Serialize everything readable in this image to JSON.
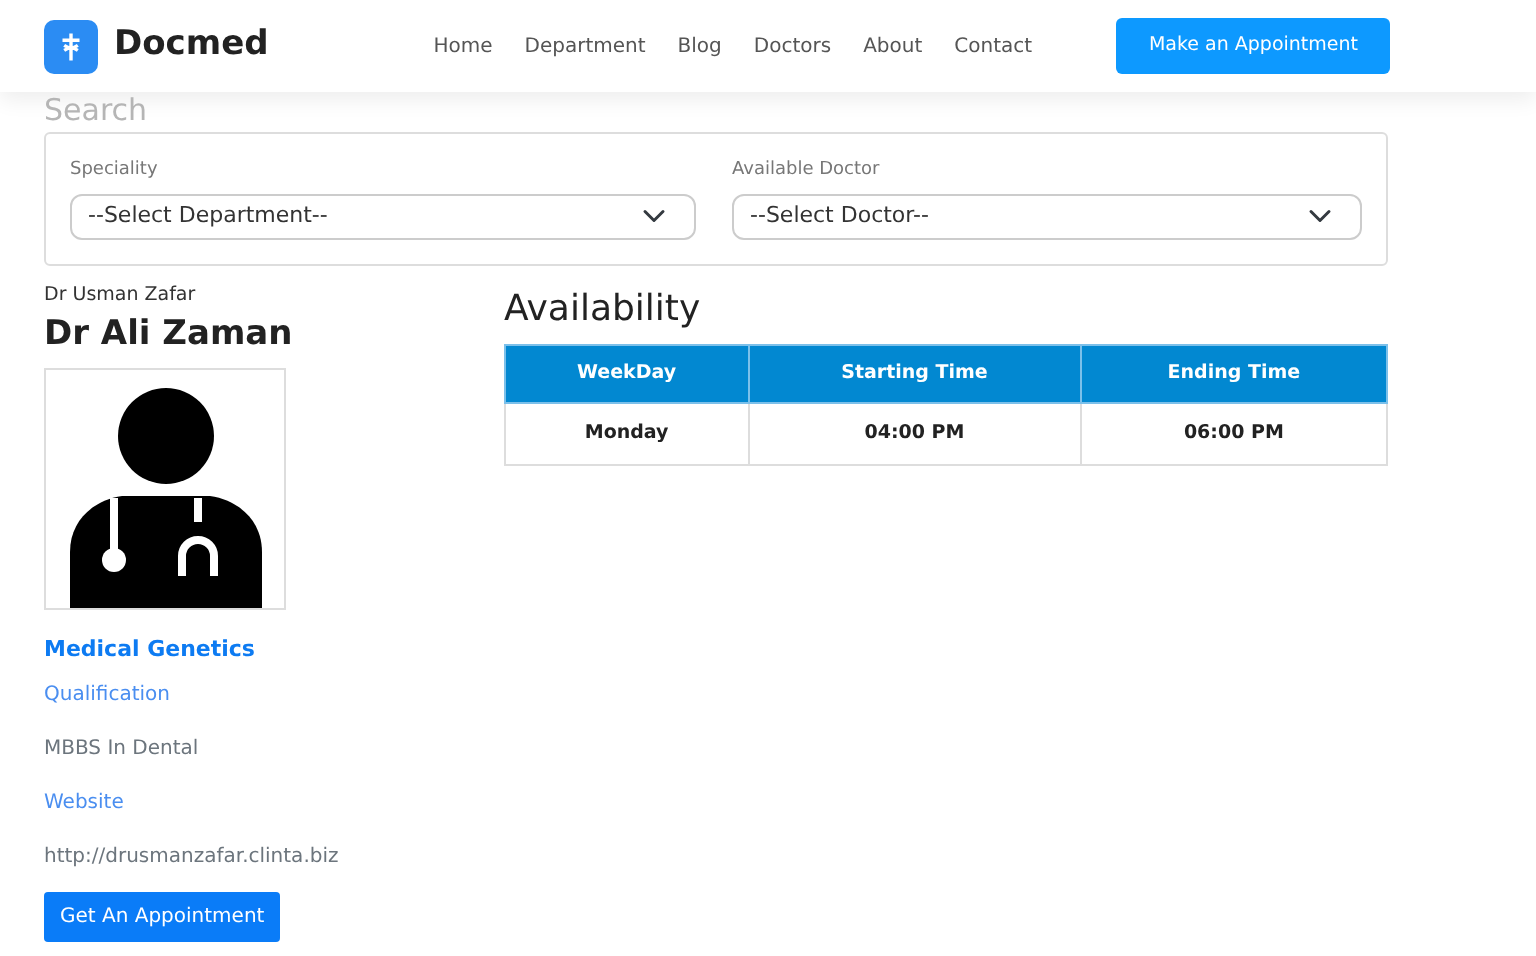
{
  "navbar": {
    "brand": "Docmed",
    "links": [
      {
        "label": "Home"
      },
      {
        "label": "Department"
      },
      {
        "label": "Blog"
      },
      {
        "label": "Doctors"
      },
      {
        "label": "About"
      },
      {
        "label": "Contact"
      }
    ],
    "cta": "Make an Appointment"
  },
  "search": {
    "title": "Search",
    "fields": [
      {
        "label": "Speciality",
        "value": "--Select Department--"
      },
      {
        "label": "Available Doctor",
        "value": "--Select Doctor--"
      }
    ]
  },
  "doctor": {
    "subtitle": "Dr Usman Zafar",
    "name": "Dr Ali Zaman",
    "speciality": "Medical Genetics",
    "qualification_label": "Qualification",
    "qualification": "MBBS In Dental",
    "website_label": "Website",
    "website": "http://drusmanzafar.clinta.biz",
    "button": "Get An Appointment"
  },
  "availability": {
    "title": "Availability",
    "columns": [
      "WeekDay",
      "Starting Time",
      "Ending Time"
    ],
    "rows": [
      [
        "Monday",
        "04:00 PM",
        "06:00 PM"
      ]
    ]
  }
}
